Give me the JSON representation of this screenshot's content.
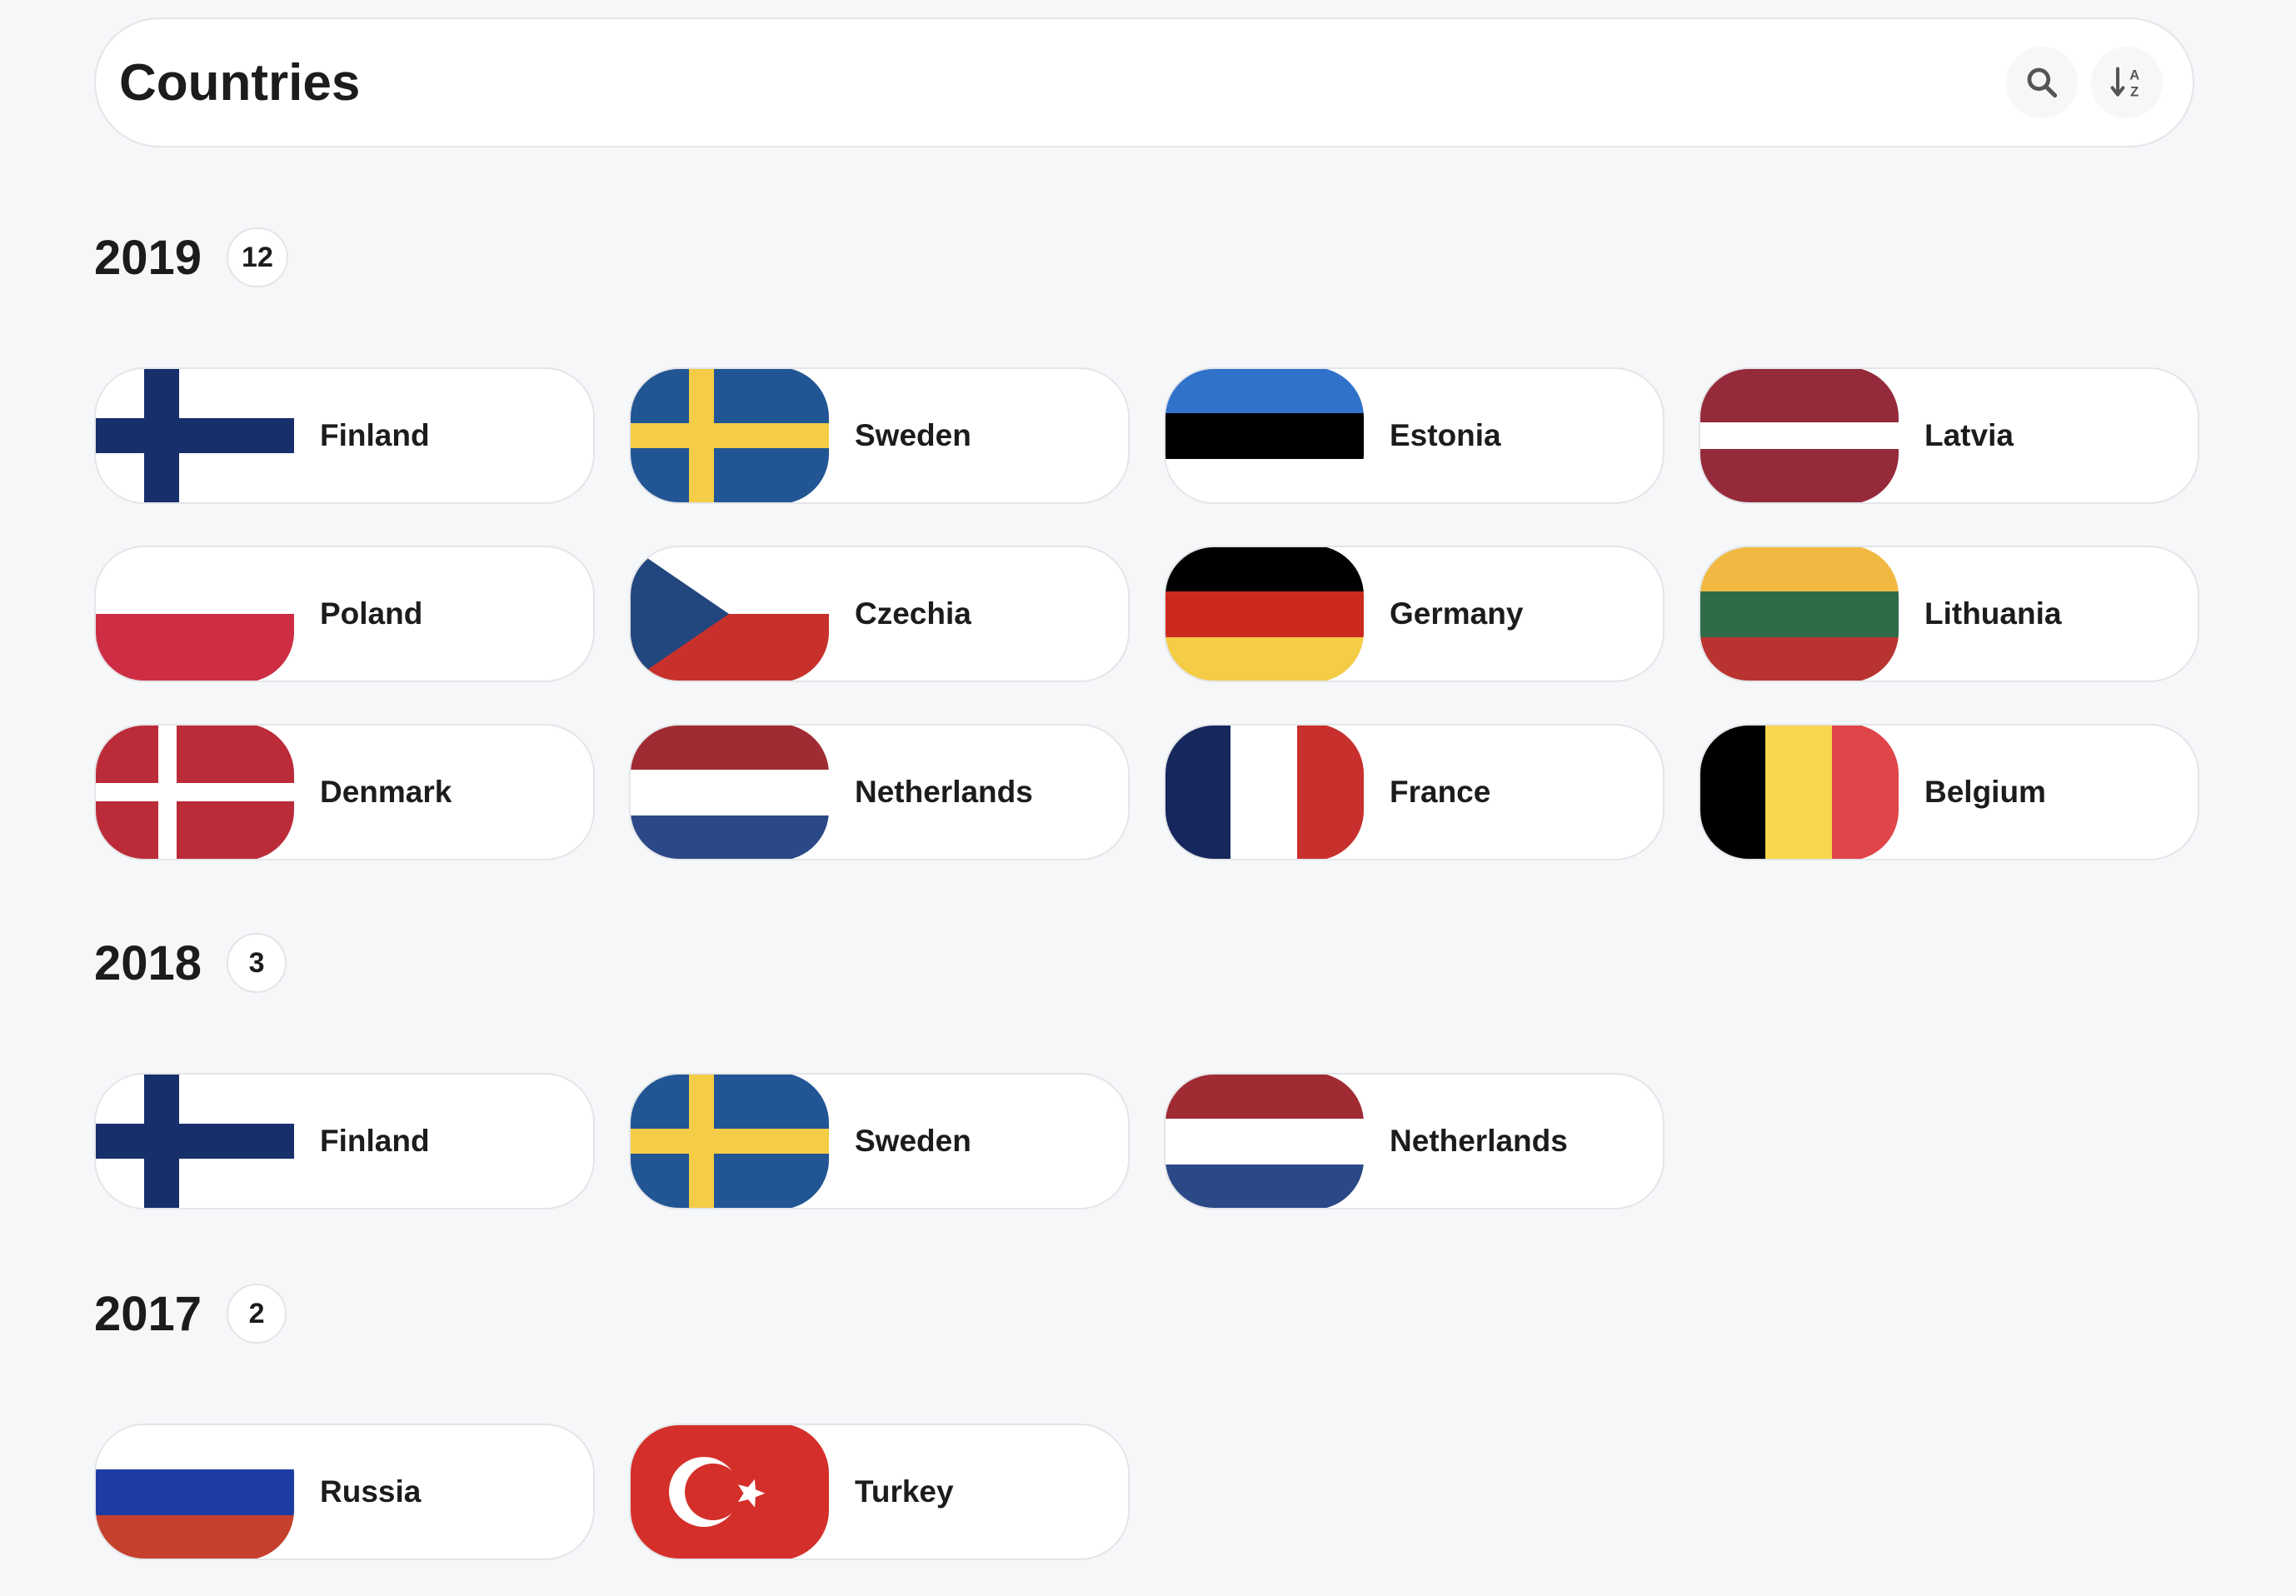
{
  "header": {
    "title": "Countries",
    "search_icon": "search-icon",
    "sort_icon": "sort-alpha-icon"
  },
  "sections": [
    {
      "year": "2019",
      "count": "12",
      "countries": [
        {
          "name": "Finland",
          "flag": "finland"
        },
        {
          "name": "Sweden",
          "flag": "sweden"
        },
        {
          "name": "Estonia",
          "flag": "estonia"
        },
        {
          "name": "Latvia",
          "flag": "latvia"
        },
        {
          "name": "Poland",
          "flag": "poland"
        },
        {
          "name": "Czechia",
          "flag": "czechia"
        },
        {
          "name": "Germany",
          "flag": "germany"
        },
        {
          "name": "Lithuania",
          "flag": "lithuania"
        },
        {
          "name": "Denmark",
          "flag": "denmark"
        },
        {
          "name": "Netherlands",
          "flag": "netherlands"
        },
        {
          "name": "France",
          "flag": "france"
        },
        {
          "name": "Belgium",
          "flag": "belgium"
        }
      ]
    },
    {
      "year": "2018",
      "count": "3",
      "countries": [
        {
          "name": "Finland",
          "flag": "finland"
        },
        {
          "name": "Sweden",
          "flag": "sweden"
        },
        {
          "name": "Netherlands",
          "flag": "netherlands"
        }
      ]
    },
    {
      "year": "2017",
      "count": "2",
      "countries": [
        {
          "name": "Russia",
          "flag": "russia"
        },
        {
          "name": "Turkey",
          "flag": "turkey"
        }
      ]
    }
  ],
  "colors": {
    "background": "#f6f7f9",
    "card": "#ffffff",
    "border": "#e3e5e8",
    "text": "#1c1c1c"
  }
}
